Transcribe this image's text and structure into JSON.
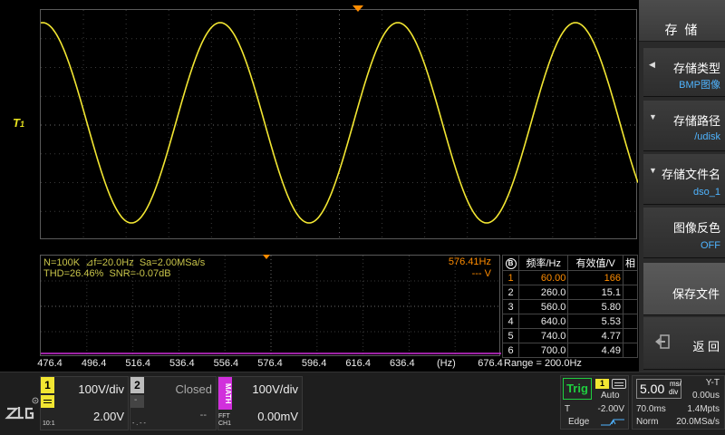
{
  "trigger_marker": "T",
  "ch1_marker_sub": "1",
  "fft": {
    "info_line1": "N=100K  ⊿f=20.0Hz  Sa=2.00MSa/s",
    "info_line2": "THD=26.46%  SNR=-0.07dB",
    "cursor_freq": "576.41Hz",
    "cursor_unit": "--- V",
    "axis_labels": [
      "476.4",
      "496.4",
      "516.4",
      "536.4",
      "556.4",
      "576.4",
      "596.4",
      "616.4",
      "636.4",
      "(Hz)",
      "676.4"
    ],
    "range": "Range = 200.0Hz"
  },
  "harmonics": {
    "icon": "B",
    "headers": [
      "频率/Hz",
      "有效值/V",
      "相"
    ],
    "rows": [
      {
        "n": "1",
        "freq": "60.00",
        "rms": "166"
      },
      {
        "n": "2",
        "freq": "260.0",
        "rms": "15.1"
      },
      {
        "n": "3",
        "freq": "560.0",
        "rms": "5.80"
      },
      {
        "n": "4",
        "freq": "640.0",
        "rms": "5.53"
      },
      {
        "n": "5",
        "freq": "740.0",
        "rms": "4.77"
      },
      {
        "n": "6",
        "freq": "700.0",
        "rms": "4.49"
      }
    ]
  },
  "menu": {
    "title": "存 储",
    "storage_type": {
      "label": "存储类型",
      "value": "BMP图像"
    },
    "storage_path": {
      "label": "存储路径",
      "value": "/udisk"
    },
    "file_name": {
      "label": "存储文件名",
      "value": "dso_1"
    },
    "invert": {
      "label": "图像反色",
      "value": "OFF"
    },
    "save": {
      "label": "保存文件"
    },
    "back": {
      "label": "返 回"
    }
  },
  "channels": {
    "ch1": {
      "num": "1",
      "scale": "100V/div",
      "offset": "2.00V",
      "probe": "10:1"
    },
    "ch2": {
      "num": "2",
      "status": "Closed",
      "offset": "--",
      "probe": "- . - -",
      "coupling": "-"
    },
    "math": {
      "num": "MATH",
      "scale": "100V/div",
      "offset": "0.00mV",
      "mode": "FFT",
      "source": "CH1"
    }
  },
  "trigger": {
    "label": "Trig",
    "source": "1",
    "mode": "Auto",
    "type_prefix": "T",
    "level": "-2.00V",
    "edge": "Edge"
  },
  "timebase": {
    "value": "5.00",
    "unit_top": "ms/",
    "unit_bottom": "div",
    "mode": "Y-T",
    "delay": "0.00us",
    "time_range": "70.0ms",
    "memory": "1.4Mpts",
    "acq_mode": "Norm",
    "sample_rate": "20.0MSa/s"
  },
  "colors": {
    "ch1": "#f2e632",
    "ch2": "#bdbdbd",
    "math": "#d12fdc",
    "trigger": "#ff8c00",
    "menu_value": "#4fb4ff",
    "trig_ok": "#1fcf3f"
  }
}
